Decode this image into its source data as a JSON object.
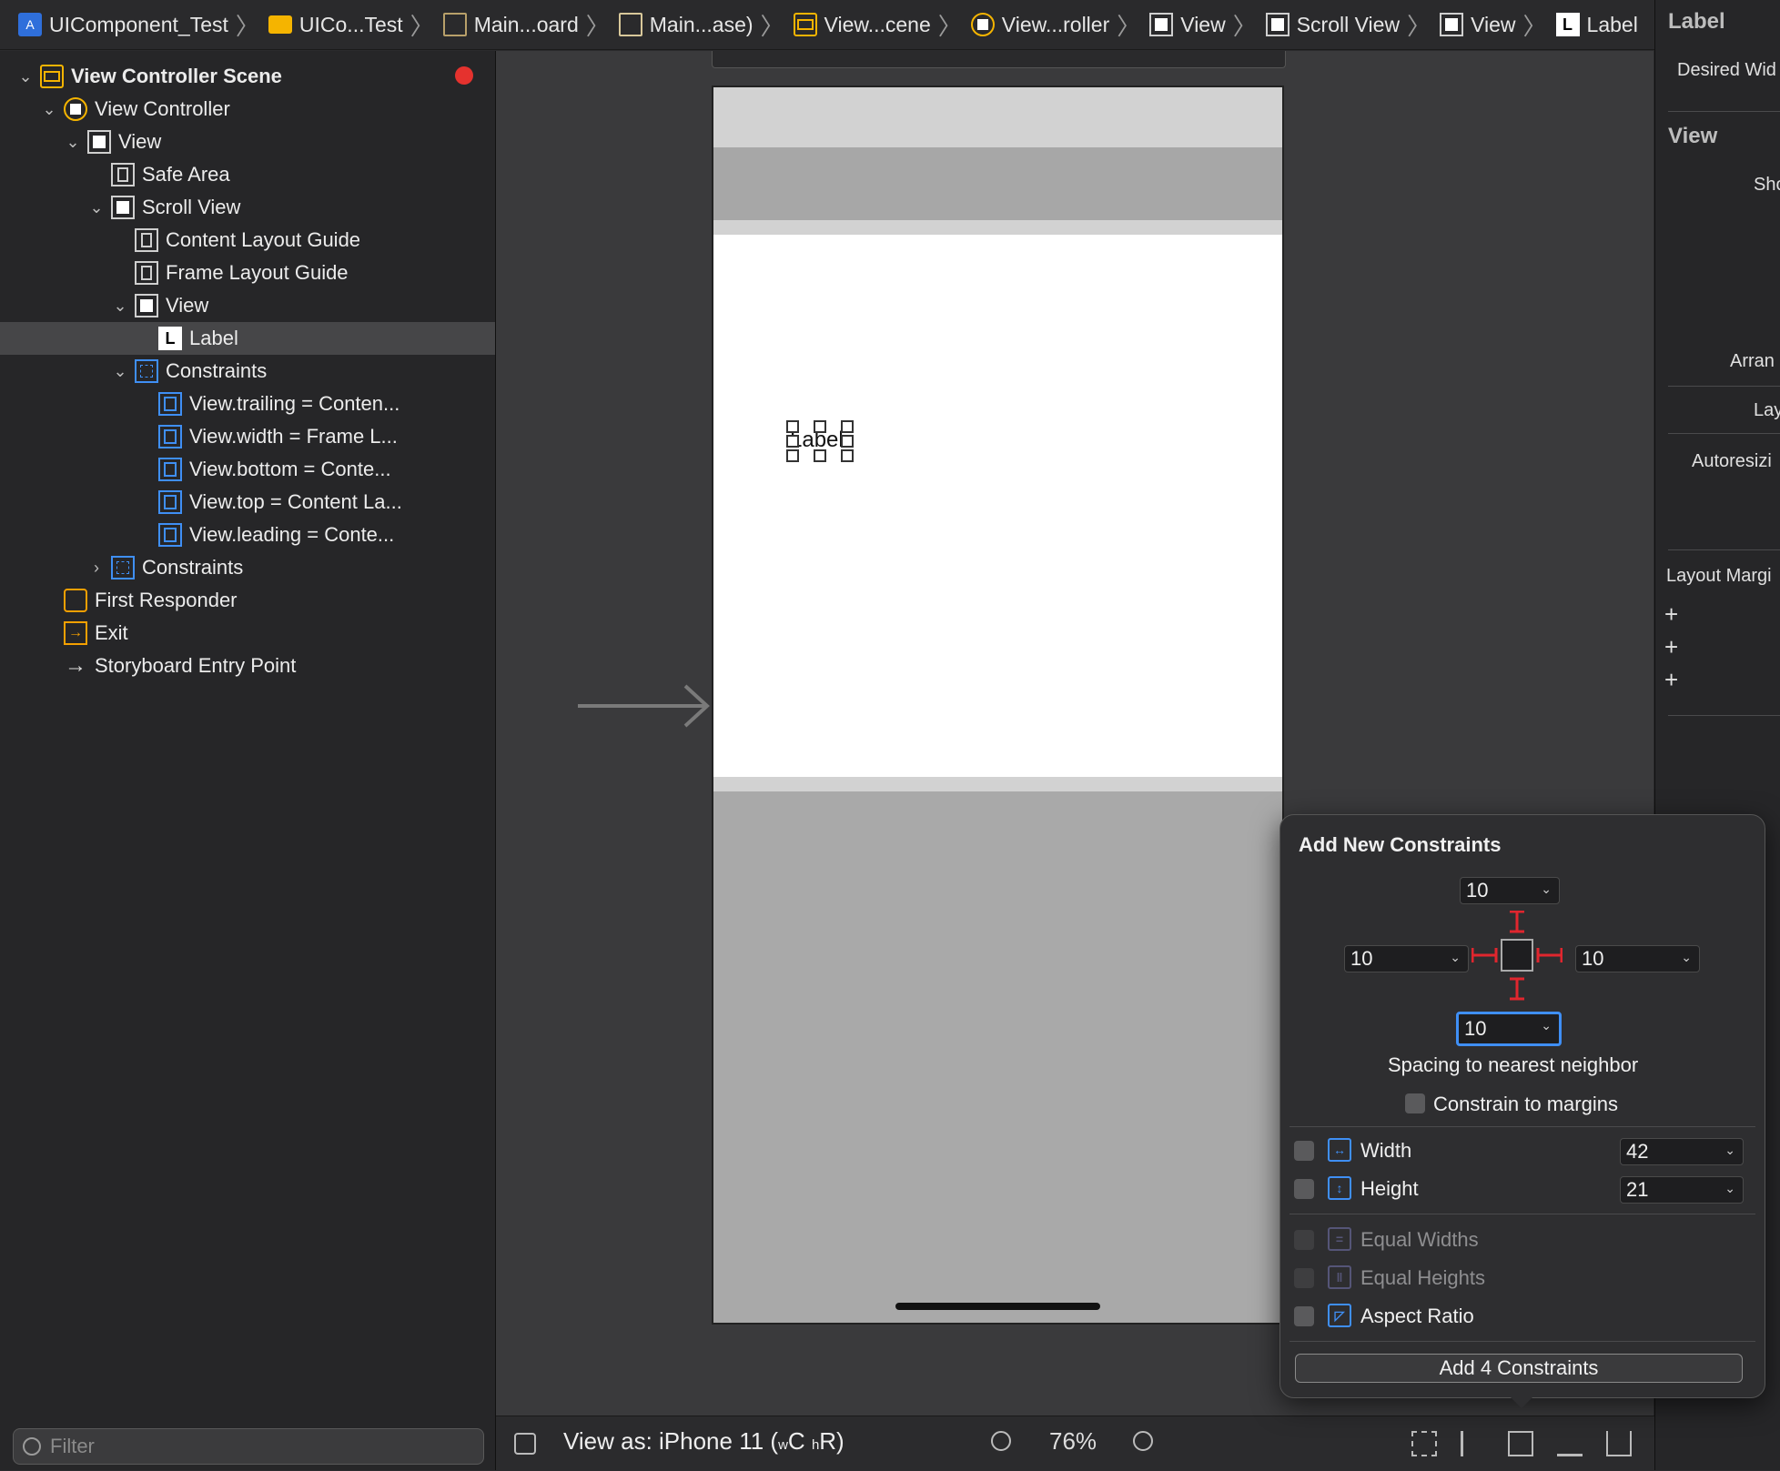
{
  "breadcrumb": [
    "UIComponent_Test",
    "UICo...Test",
    "Main...oard",
    "Main...ase)",
    "View...cene",
    "View...roller",
    "View",
    "Scroll View",
    "View",
    "Label"
  ],
  "navigator": {
    "rows": [
      {
        "label": "View Controller Scene",
        "level": 0,
        "icon": "scene-icon",
        "disclosure": "open"
      },
      {
        "label": "View Controller",
        "level": 1,
        "icon": "view-controller-icon",
        "disclosure": "open"
      },
      {
        "label": "View",
        "level": 2,
        "icon": "view-icon",
        "disclosure": "open"
      },
      {
        "label": "Safe Area",
        "level": 3,
        "icon": "layout-guide-icon",
        "disclosure": "none"
      },
      {
        "label": "Scroll View",
        "level": 3,
        "icon": "view-icon",
        "disclosure": "open"
      },
      {
        "label": "Content Layout Guide",
        "level": 4,
        "icon": "layout-guide-icon",
        "disclosure": "none"
      },
      {
        "label": "Frame Layout Guide",
        "level": 4,
        "icon": "layout-guide-icon",
        "disclosure": "none"
      },
      {
        "label": "View",
        "level": 4,
        "icon": "view-icon",
        "disclosure": "open"
      },
      {
        "label": "Label",
        "level": 5,
        "icon": "label-icon",
        "disclosure": "none",
        "selected": true
      },
      {
        "label": "Constraints",
        "level": 4,
        "icon": "constraints-icon",
        "disclosure": "open"
      },
      {
        "label": "View.trailing = Conten...",
        "level": 5,
        "icon": "constraint-icon",
        "disclosure": "none"
      },
      {
        "label": "View.width = Frame L...",
        "level": 5,
        "icon": "constraint-icon",
        "disclosure": "none"
      },
      {
        "label": "View.bottom = Conte...",
        "level": 5,
        "icon": "constraint-icon",
        "disclosure": "none"
      },
      {
        "label": "View.top = Content La...",
        "level": 5,
        "icon": "constraint-icon",
        "disclosure": "none"
      },
      {
        "label": "View.leading = Conte...",
        "level": 5,
        "icon": "constraint-icon",
        "disclosure": "none"
      },
      {
        "label": "Constraints",
        "level": 3,
        "icon": "constraints-icon",
        "disclosure": "closed"
      },
      {
        "label": "First Responder",
        "level": 1,
        "icon": "first-responder-icon",
        "disclosure": "none"
      },
      {
        "label": "Exit",
        "level": 1,
        "icon": "exit-icon",
        "disclosure": "none"
      },
      {
        "label": "Storyboard Entry Point",
        "level": 1,
        "icon": "arrow-right-icon",
        "disclosure": "none"
      }
    ],
    "filter_placeholder": "Filter"
  },
  "canvas": {
    "label_text": "Label"
  },
  "bottombar": {
    "view_as": "View as: iPhone 11 (",
    "size_w": "w",
    "size_C": "C",
    "size_h": "h",
    "size_R": "R)",
    "zoom": "76%"
  },
  "inspector": {
    "title": "Label",
    "desired_width": "Desired Wid",
    "view_header": "View",
    "show": "Sho",
    "arrange": "Arran",
    "layout": "Layo",
    "autoresizing": "Autoresizi",
    "layout_margins": "Layout Margi"
  },
  "popover": {
    "title": "Add New Constraints",
    "top": "10",
    "left": "10",
    "right": "10",
    "bottom": "10",
    "spacing_caption": "Spacing to nearest neighbor",
    "constrain_margins": "Constrain to margins",
    "width_label": "Width",
    "width_value": "42",
    "height_label": "Height",
    "height_value": "21",
    "equal_widths": "Equal Widths",
    "equal_heights": "Equal Heights",
    "aspect_ratio": "Aspect Ratio",
    "add_button": "Add 4 Constraints",
    "accent_color": "#3f8ff5",
    "pin_color": "#e0262e"
  }
}
